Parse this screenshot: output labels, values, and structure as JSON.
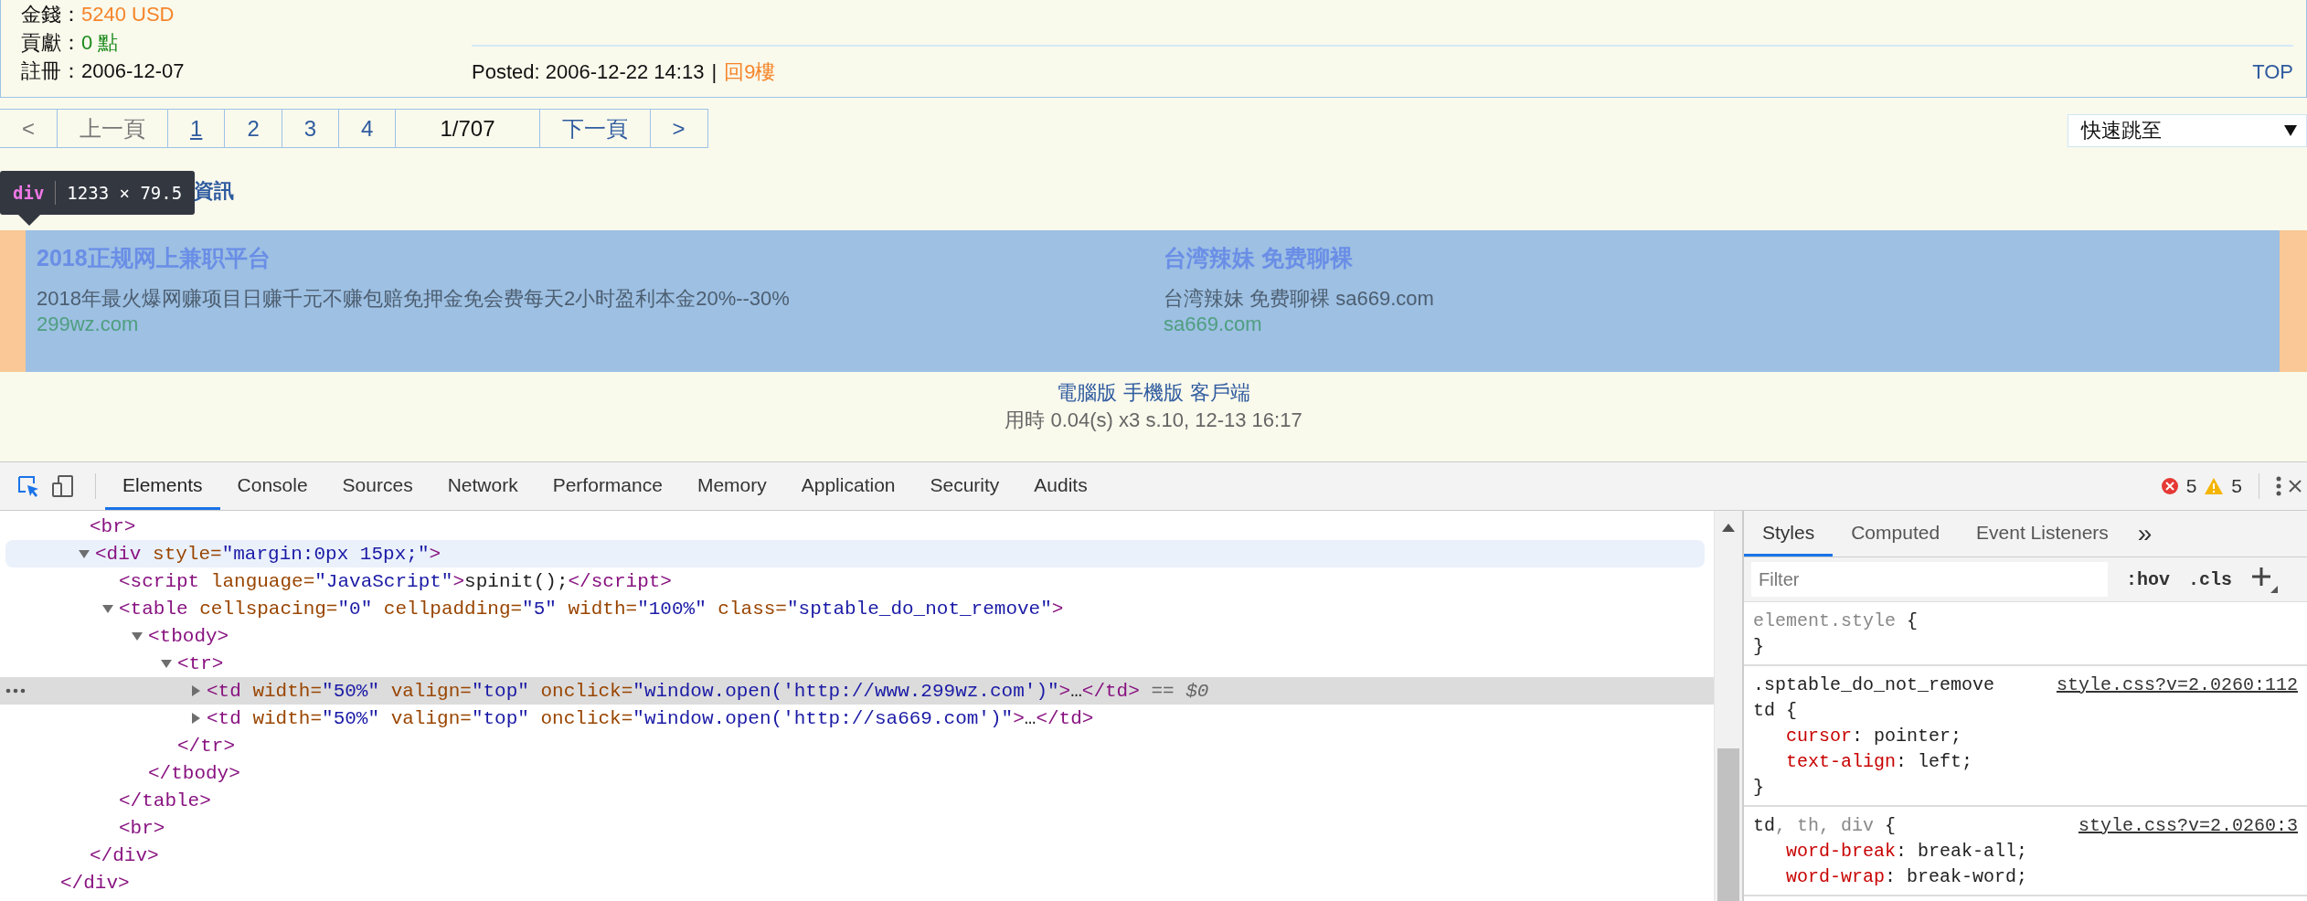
{
  "page": {
    "author_info": [
      {
        "label": "金錢：",
        "value": "5240 USD",
        "color": "#f5852a"
      },
      {
        "label": "貢獻：",
        "value": "0 點",
        "color": "#1a8a1a"
      },
      {
        "label": "註冊：",
        "value": "2006-12-07",
        "color": "#111111"
      }
    ],
    "post_meta": {
      "posted": "Posted: 2006-12-22 14:13",
      "separator": "|",
      "reply_link": "回9樓"
    },
    "top_link": "TOP",
    "pagination": [
      {
        "label": "<",
        "kind": "nav",
        "disabled": true,
        "selected": false
      },
      {
        "label": "上一頁",
        "kind": "nav",
        "disabled": true,
        "selected": false
      },
      {
        "label": "1",
        "kind": "page",
        "disabled": false,
        "selected": true
      },
      {
        "label": "2",
        "kind": "page",
        "disabled": false,
        "selected": false
      },
      {
        "label": "3",
        "kind": "page",
        "disabled": false,
        "selected": false
      },
      {
        "label": "4",
        "kind": "page",
        "disabled": false,
        "selected": false
      },
      {
        "label": "1/707",
        "kind": "count",
        "disabled": false,
        "selected": false
      },
      {
        "label": "下一頁",
        "kind": "nav",
        "disabled": false,
        "selected": false
      },
      {
        "label": ">",
        "kind": "nav",
        "disabled": false,
        "selected": false
      }
    ],
    "quick_jump": {
      "value": "快速跳至"
    },
    "section_heading": "資訊",
    "ads": [
      {
        "title": "2018正规网上兼职平台",
        "description": "2018年最火爆网赚项目日赚千元不赚包赔免押金免会费每天2小时盈利本金20%--30%",
        "url": "299wz.com"
      },
      {
        "title": "台湾辣妹 免费聊裸",
        "description": "台湾辣妹 免费聊裸 sa669.com",
        "url": "sa669.com"
      }
    ],
    "footer": {
      "links": [
        "電腦版",
        "手機版",
        "客戶端"
      ],
      "stats": "用時 0.04(s) x3 s.10, 12-13 16:17"
    }
  },
  "inspect_tooltip": {
    "tag": "div",
    "size": "1233 × 79.5"
  },
  "devtools": {
    "inspect_active": true,
    "tabs": [
      {
        "label": "Elements",
        "selected": true
      },
      {
        "label": "Console",
        "selected": false
      },
      {
        "label": "Sources",
        "selected": false
      },
      {
        "label": "Network",
        "selected": false
      },
      {
        "label": "Performance",
        "selected": false
      },
      {
        "label": "Memory",
        "selected": false
      },
      {
        "label": "Application",
        "selected": false
      },
      {
        "label": "Security",
        "selected": false
      },
      {
        "label": "Audits",
        "selected": false
      }
    ],
    "errors": "5",
    "warnings": "5",
    "dom_tree": {
      "close_tokens": [
        {
          "kind": "tag",
          "text": "</div>"
        }
      ],
      "children": [
        {
          "tokens": [
            {
              "kind": "tag",
              "text": "<br>"
            }
          ],
          "selected": false,
          "hovered": false
        },
        {
          "tokens": [
            {
              "kind": "tag",
              "text": "<div"
            },
            {
              "kind": "attr",
              "text": " style="
            },
            {
              "kind": "value",
              "text": "\"margin:0px 15px;\""
            },
            {
              "kind": "tag",
              "text": ">"
            }
          ],
          "expanded": true,
          "selected": false,
          "hovered": true,
          "close_tokens": [
            {
              "kind": "tag",
              "text": "</div>"
            }
          ],
          "children": [
            {
              "tokens": [
                {
                  "kind": "tag",
                  "text": "<script"
                },
                {
                  "kind": "attr",
                  "text": " language="
                },
                {
                  "kind": "value",
                  "text": "\"JavaScript\""
                },
                {
                  "kind": "tag",
                  "text": ">"
                },
                {
                  "kind": "text",
                  "text": "spinit();"
                },
                {
                  "kind": "tag",
                  "text": "</script>"
                }
              ],
              "selected": false,
              "hovered": false
            },
            {
              "tokens": [
                {
                  "kind": "tag",
                  "text": "<table"
                },
                {
                  "kind": "attr",
                  "text": " cellspacing="
                },
                {
                  "kind": "value",
                  "text": "\"0\""
                },
                {
                  "kind": "attr",
                  "text": " cellpadding="
                },
                {
                  "kind": "value",
                  "text": "\"5\""
                },
                {
                  "kind": "attr",
                  "text": " width="
                },
                {
                  "kind": "value",
                  "text": "\"100%\""
                },
                {
                  "kind": "attr",
                  "text": " class="
                },
                {
                  "kind": "value",
                  "text": "\"sptable_do_not_remove\""
                },
                {
                  "kind": "tag",
                  "text": ">"
                }
              ],
              "expanded": true,
              "selected": false,
              "hovered": false,
              "close_tokens": [
                {
                  "kind": "tag",
                  "text": "</table>"
                }
              ],
              "children": [
                {
                  "tokens": [
                    {
                      "kind": "tag",
                      "text": "<tbody>"
                    }
                  ],
                  "expanded": true,
                  "selected": false,
                  "hovered": false,
                  "close_tokens": [
                    {
                      "kind": "tag",
                      "text": "</tbody>"
                    }
                  ],
                  "children": [
                    {
                      "tokens": [
                        {
                          "kind": "tag",
                          "text": "<tr>"
                        }
                      ],
                      "expanded": true,
                      "selected": false,
                      "hovered": false,
                      "close_tokens": [
                        {
                          "kind": "tag",
                          "text": "</tr>"
                        }
                      ],
                      "children": [
                        {
                          "tokens": [
                            {
                              "kind": "tag",
                              "text": "<td"
                            },
                            {
                              "kind": "attr",
                              "text": " width="
                            },
                            {
                              "kind": "value",
                              "text": "\"50%\""
                            },
                            {
                              "kind": "attr",
                              "text": " valign="
                            },
                            {
                              "kind": "value",
                              "text": "\"top\""
                            },
                            {
                              "kind": "attr",
                              "text": " onclick="
                            },
                            {
                              "kind": "value",
                              "text": "\"window.open('http://www.299wz.com')\""
                            },
                            {
                              "kind": "tag",
                              "text": ">"
                            },
                            {
                              "kind": "text",
                              "text": "…"
                            },
                            {
                              "kind": "tag",
                              "text": "</td>"
                            },
                            {
                              "kind": "note",
                              "text": " == $0"
                            }
                          ],
                          "expanded": false,
                          "selected": true,
                          "hovered": false
                        },
                        {
                          "tokens": [
                            {
                              "kind": "tag",
                              "text": "<td"
                            },
                            {
                              "kind": "attr",
                              "text": " width="
                            },
                            {
                              "kind": "value",
                              "text": "\"50%\""
                            },
                            {
                              "kind": "attr",
                              "text": " valign="
                            },
                            {
                              "kind": "value",
                              "text": "\"top\""
                            },
                            {
                              "kind": "attr",
                              "text": " onclick="
                            },
                            {
                              "kind": "value",
                              "text": "\"window.open('http://sa669.com')\""
                            },
                            {
                              "kind": "tag",
                              "text": ">"
                            },
                            {
                              "kind": "text",
                              "text": "…"
                            },
                            {
                              "kind": "tag",
                              "text": "</td>"
                            }
                          ],
                          "expanded": false,
                          "selected": false,
                          "hovered": false
                        }
                      ]
                    }
                  ]
                }
              ]
            },
            {
              "tokens": [
                {
                  "kind": "tag",
                  "text": "<br>"
                }
              ],
              "selected": false,
              "hovered": false
            }
          ]
        }
      ]
    },
    "styles": {
      "tabs": [
        {
          "label": "Styles",
          "selected": true
        },
        {
          "label": "Computed",
          "selected": false
        },
        {
          "label": "Event Listeners",
          "selected": false
        }
      ],
      "more": "»",
      "filter_placeholder": "Filter",
      "hov": ":hov",
      "cls": ".cls",
      "rules": [
        {
          "selector_lines": [
            [
              {
                "text": "element.style",
                "dim": true
              },
              {
                "text": " {",
                "dim": false
              }
            ]
          ],
          "closing": "}"
        },
        {
          "selector_lines": [
            [
              {
                "text": ".sptable_do_not_remove",
                "dim": false
              }
            ],
            [
              {
                "text": "td {",
                "dim": false
              }
            ]
          ],
          "source": "style.css?v=2.0260:112",
          "properties": [
            {
              "name": "cursor",
              "value": ": pointer;"
            },
            {
              "name": "text-align",
              "value": ": left;"
            }
          ],
          "closing": "}"
        },
        {
          "selector_lines": [
            [
              {
                "text": "td",
                "dim": false
              },
              {
                "text": ", th, div",
                "dim": true
              },
              {
                "text": " {",
                "dim": false
              }
            ]
          ],
          "source": "style.css?v=2.0260:3",
          "properties": [
            {
              "name": "word-break",
              "value": ": break-all;"
            },
            {
              "name": "word-wrap",
              "value": ": break-word;"
            }
          ]
        }
      ]
    }
  }
}
